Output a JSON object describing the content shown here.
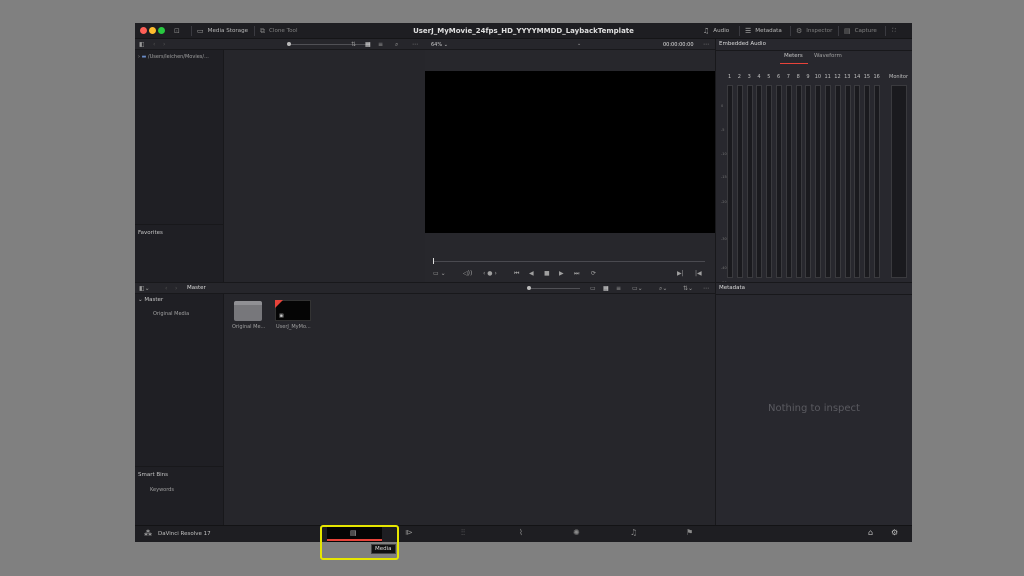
{
  "window": {
    "title": "UserJ_MyMovie_24fps_HD_YYYYMMDD_LaybackTemplate",
    "colors": {
      "close": "#fe5f57",
      "minimize": "#febc2e",
      "maximize": "#28c840",
      "highlight": "#e6e600",
      "accent_red": "#e8433a"
    }
  },
  "titlebar": {
    "media_storage": "Media Storage",
    "clone_tool": "Clone Tool",
    "audio": "Audio",
    "metadata": "Metadata",
    "inspector": "Inspector",
    "capture": "Capture"
  },
  "media_storage": {
    "path": "/Users/leichen/Movies/...",
    "favorites": "Favorites"
  },
  "viewer": {
    "zoom": "64%",
    "timecode": "00:00:00:00",
    "progress": 0
  },
  "audio_panel": {
    "title": "Embedded Audio",
    "tabs": [
      "Meters",
      "Waveform"
    ],
    "active_tab": "Meters",
    "channels": [
      "1",
      "2",
      "3",
      "4",
      "5",
      "6",
      "7",
      "8",
      "9",
      "10",
      "11",
      "12",
      "13",
      "14",
      "15",
      "16"
    ],
    "monitor": "Monitor",
    "scale": [
      "0",
      "-5",
      "-10",
      "-15",
      "-20",
      "-30",
      "-40",
      "-50"
    ]
  },
  "media_pool": {
    "bin": "Master",
    "tree": {
      "master": "Master",
      "original_media": "Original Media"
    },
    "items": [
      {
        "label": "Original Me...",
        "kind": "folder"
      },
      {
        "label": "UserJ_MyMo...",
        "kind": "clip"
      }
    ],
    "smart_bins": "Smart Bins",
    "keywords": "Keywords"
  },
  "metadata_panel": {
    "title": "Metadata",
    "empty": "Nothing to inspect"
  },
  "bottom": {
    "app_name": "DaVinci Resolve 17",
    "tooltip": "Media"
  },
  "icons": {
    "logo": "davinci-logo-icon",
    "pages": [
      "media-page-icon",
      "cut-page-icon",
      "edit-page-icon",
      "fusion-page-icon",
      "color-page-icon",
      "fairlight-page-icon",
      "deliver-page-icon"
    ],
    "home": "home-icon",
    "settings": "gear-icon"
  }
}
